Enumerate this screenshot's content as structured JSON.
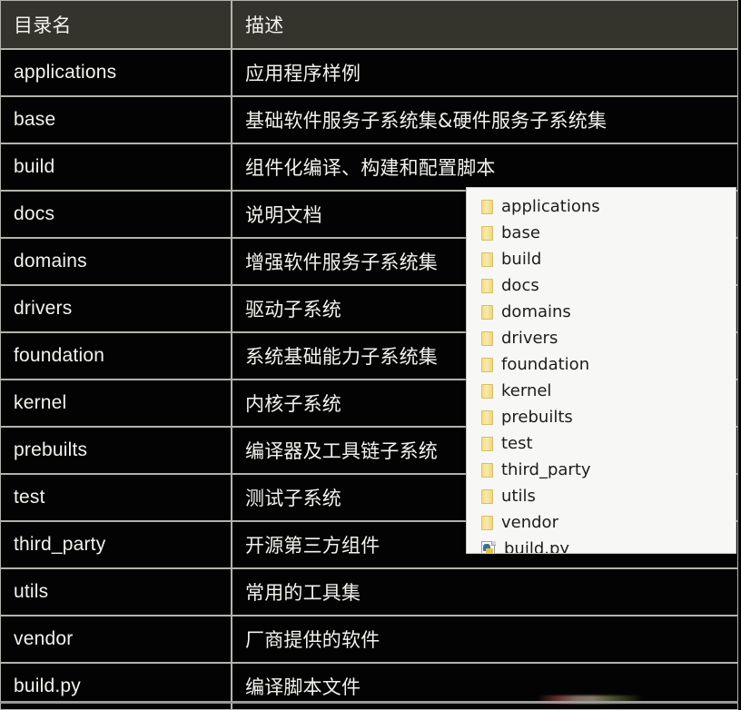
{
  "table": {
    "columns": [
      "目录名",
      "描述"
    ],
    "rows": [
      {
        "name": "applications",
        "desc": "应用程序样例"
      },
      {
        "name": "base",
        "desc": "基础软件服务子系统集&硬件服务子系统集"
      },
      {
        "name": "build",
        "desc": "组件化编译、构建和配置脚本"
      },
      {
        "name": "docs",
        "desc": "说明文档"
      },
      {
        "name": "domains",
        "desc": "增强软件服务子系统集"
      },
      {
        "name": "drivers",
        "desc": "驱动子系统"
      },
      {
        "name": "foundation",
        "desc": "系统基础能力子系统集"
      },
      {
        "name": "kernel",
        "desc": "内核子系统"
      },
      {
        "name": "prebuilts",
        "desc": "编译器及工具链子系统"
      },
      {
        "name": "test",
        "desc": "测试子系统"
      },
      {
        "name": "third_party",
        "desc": "开源第三方组件"
      },
      {
        "name": "utils",
        "desc": "常用的工具集"
      },
      {
        "name": "vendor",
        "desc": "厂商提供的软件"
      },
      {
        "name": "build.py",
        "desc": "编译脚本文件"
      }
    ]
  },
  "file_tree": {
    "items": [
      {
        "label": "applications",
        "icon": "folder-icon"
      },
      {
        "label": "base",
        "icon": "folder-icon"
      },
      {
        "label": "build",
        "icon": "folder-icon"
      },
      {
        "label": "docs",
        "icon": "folder-icon"
      },
      {
        "label": "domains",
        "icon": "folder-icon"
      },
      {
        "label": "drivers",
        "icon": "folder-icon"
      },
      {
        "label": "foundation",
        "icon": "folder-icon"
      },
      {
        "label": "kernel",
        "icon": "folder-icon"
      },
      {
        "label": "prebuilts",
        "icon": "folder-icon"
      },
      {
        "label": "test",
        "icon": "folder-icon"
      },
      {
        "label": "third_party",
        "icon": "folder-icon"
      },
      {
        "label": "utils",
        "icon": "folder-icon"
      },
      {
        "label": "vendor",
        "icon": "folder-icon"
      },
      {
        "label": "build.py",
        "icon": "python-file-icon"
      }
    ]
  },
  "colors": {
    "header_background": "#35342c",
    "table_background": "#030303",
    "table_border": "#b3b3ad",
    "table_text": "#f2f2ee",
    "panel_background": "#f7f7f5",
    "panel_border": "#c9c9c4",
    "panel_text": "#1d1d1d",
    "folder_icon": "#f2dd8b"
  }
}
